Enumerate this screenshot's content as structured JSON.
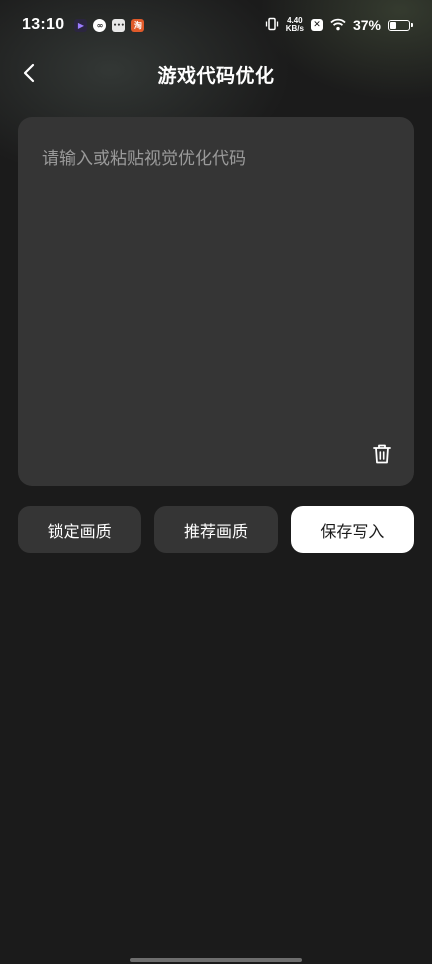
{
  "status_bar": {
    "time": "13:10",
    "notification_icons": [
      "video-app-icon",
      "link-app-icon",
      "chat-app-icon",
      "shopping-app-icon"
    ],
    "net_speed_value": "4.40",
    "net_speed_unit": "KB/s",
    "battery_percent": "37%",
    "battery_level": 0.37
  },
  "header": {
    "back_icon": "chevron-left-icon",
    "title": "游戏代码优化"
  },
  "code_input": {
    "placeholder": "请输入或粘贴视觉优化代码",
    "value": "",
    "clear_icon": "trash-icon"
  },
  "actions": {
    "lock_quality_label": "锁定画质",
    "recommend_quality_label": "推荐画质",
    "save_write_label": "保存写入"
  },
  "colors": {
    "background": "#1b1b1b",
    "panel": "#353535",
    "primary_button": "#ffffff",
    "placeholder_text": "#9a9a9a"
  }
}
